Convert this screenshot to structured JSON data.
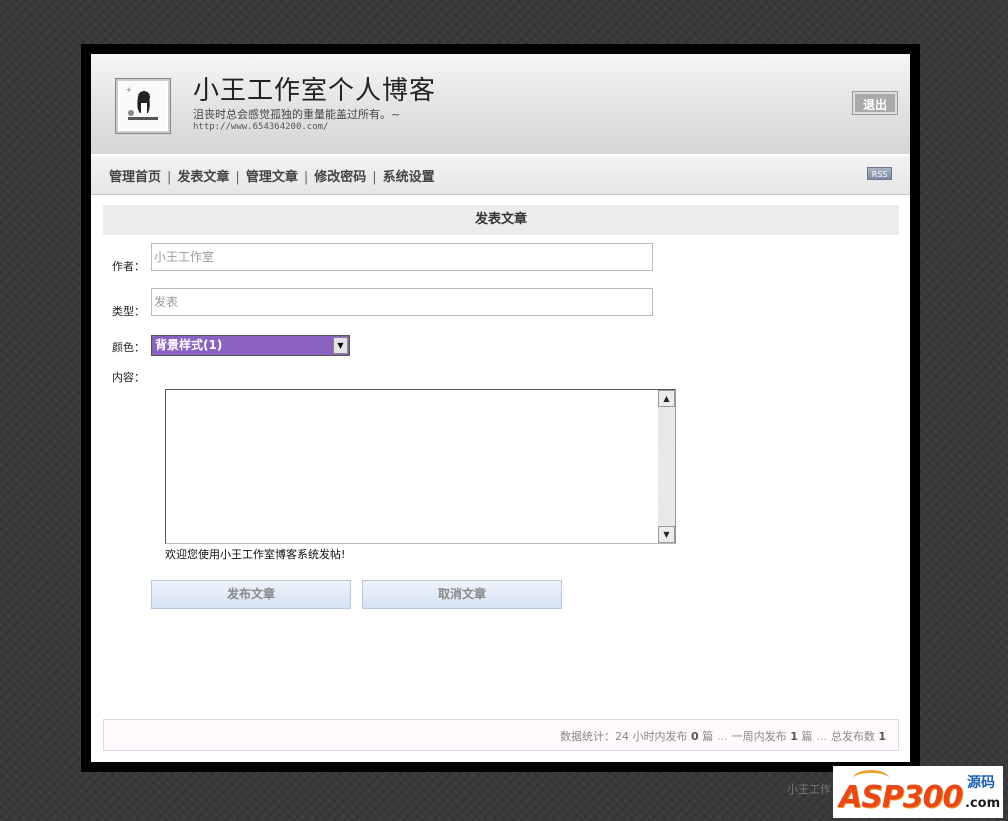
{
  "colors": {
    "frame": "#000000",
    "select_bg": "#8a63c2",
    "button_bg": "#d6e2f4",
    "brand_red": "#e8471a",
    "brand_blue": "#1c5fb3"
  },
  "header": {
    "title": "小王工作室个人博客",
    "slogan": "沮丧时总会感觉孤独的重量能盖过所有。~",
    "url": "http://www.654364200.com/",
    "logout_label": "退出",
    "logo_icon": "avatar-icon"
  },
  "nav": {
    "items": [
      {
        "label": "管理首页"
      },
      {
        "label": "发表文章"
      },
      {
        "label": "管理文章"
      },
      {
        "label": "修改密码"
      },
      {
        "label": "系统设置"
      }
    ],
    "separator": "|",
    "rss_label": "RSS"
  },
  "form": {
    "section_title": "发表文章",
    "author_label": "作者：",
    "author_value": "小王工作室",
    "type_label": "类型：",
    "type_value": "发表",
    "color_label": "颜色：",
    "color_selected": "背景样式(1)",
    "content_label": "内容：",
    "content_value": "",
    "welcome_note": "欢迎您使用小王工作室博客系统发帖!",
    "submit_label": "发布文章",
    "cancel_label": "取消文章"
  },
  "stats": {
    "prefix": "数据统计：",
    "hours": "24",
    "hours_suffix": "小时内发布",
    "day_count": "0",
    "unit": "篇",
    "dots": "...",
    "week_prefix": "一周内发布",
    "week_count": "1",
    "total_prefix": "总发布数",
    "total_count": "1"
  },
  "footer": {
    "text": "小王工作",
    "brand_main": "ASP300",
    "brand_cn": "源码",
    "brand_com": ".com"
  }
}
